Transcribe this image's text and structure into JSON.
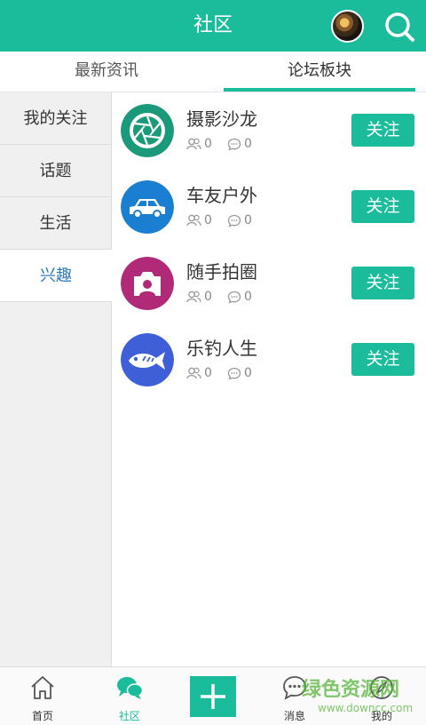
{
  "header": {
    "title": "社区",
    "avatar_icon": "user-avatar",
    "search_icon": "search-icon"
  },
  "tabs": [
    {
      "label": "最新资讯",
      "active": false
    },
    {
      "label": "论坛板块",
      "active": true
    }
  ],
  "sidebar": {
    "items": [
      {
        "label": "我的关注",
        "active": false
      },
      {
        "label": "话题",
        "active": false
      },
      {
        "label": "生活",
        "active": false
      },
      {
        "label": "兴趣",
        "active": true
      }
    ]
  },
  "forums": [
    {
      "name": "摄影沙龙",
      "members": "0",
      "comments": "0",
      "follow_label": "关注",
      "icon": "camera-aperture-icon",
      "color": "#1a9a7a"
    },
    {
      "name": "车友户外",
      "members": "0",
      "comments": "0",
      "follow_label": "关注",
      "icon": "car-icon",
      "color": "#1a7fd0"
    },
    {
      "name": "随手拍圈",
      "members": "0",
      "comments": "0",
      "follow_label": "关注",
      "icon": "photo-camera-icon",
      "color": "#b02a78"
    },
    {
      "name": "乐钓人生",
      "members": "0",
      "comments": "0",
      "follow_label": "关注",
      "icon": "fish-icon",
      "color": "#3f5fd8"
    }
  ],
  "bottom_nav": {
    "items": [
      {
        "label": "首页",
        "icon": "home-icon",
        "active": false
      },
      {
        "label": "社区",
        "icon": "chat-bubbles-icon",
        "active": true
      },
      {
        "label": "",
        "icon": "plus-icon",
        "active": false
      },
      {
        "label": "消息",
        "icon": "message-icon",
        "active": false
      },
      {
        "label": "我的",
        "icon": "compass-icon",
        "active": false
      }
    ]
  },
  "watermark": {
    "text": "绿色资源网",
    "url": "www.downcc.com"
  },
  "colors": {
    "accent": "#1bbc9b",
    "active_sidebar_text": "#2e7ac0"
  }
}
